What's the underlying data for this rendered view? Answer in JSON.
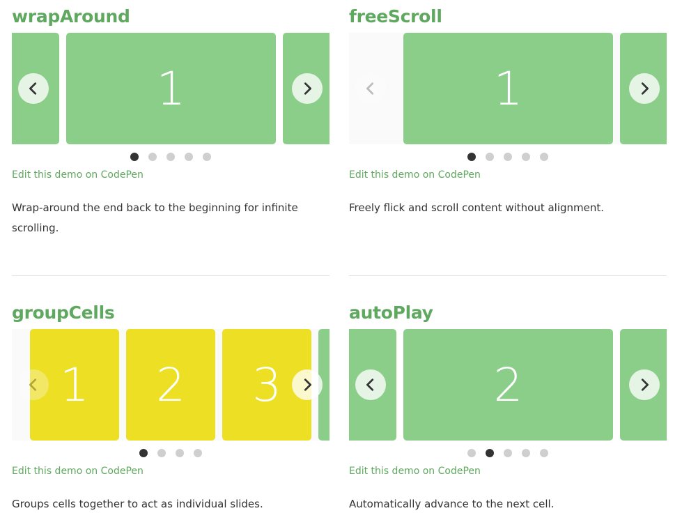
{
  "demos": {
    "wrap": {
      "title": "wrapAround",
      "cells": [
        "",
        "1",
        ""
      ],
      "dots": 5,
      "active_dot": 1,
      "link": "Edit this demo on CodePen",
      "description": "Wrap-around the end back to the beginning for infinite scrolling."
    },
    "free": {
      "title": "freeScroll",
      "cells": [
        "1",
        ""
      ],
      "dots": 5,
      "active_dot": 1,
      "link": "Edit this demo on CodePen",
      "description": "Freely flick and scroll content without alignment."
    },
    "group": {
      "title": "groupCells",
      "cells": [
        "1",
        "2",
        "3",
        ""
      ],
      "dots": 4,
      "active_dot": 1,
      "link": "Edit this demo on CodePen",
      "description": "Groups cells together to act as individual slides."
    },
    "auto": {
      "title": "autoPlay",
      "cells": [
        "",
        "2",
        ""
      ],
      "dots": 5,
      "active_dot": 2,
      "link": "Edit this demo on CodePen",
      "description": "Automatically advance to the next cell."
    }
  },
  "icons": {
    "prev": "chevron-left-icon",
    "next": "chevron-right-icon"
  },
  "colors": {
    "accent": "#5fa85f",
    "cell_green": "#8ace8a",
    "cell_yellow": "#eddf23",
    "dot_active": "#333333",
    "dot_inactive": "#cfcfcf"
  }
}
